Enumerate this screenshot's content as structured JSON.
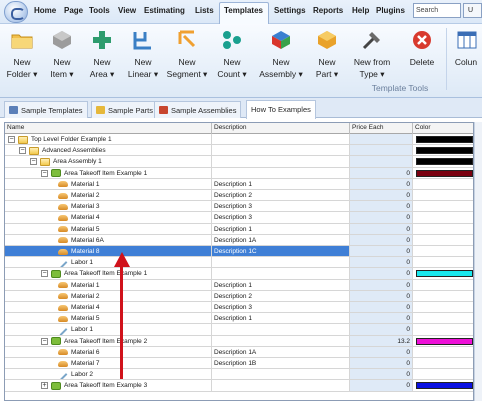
{
  "menu": {
    "items": [
      "Home",
      "Page",
      "Tools",
      "View",
      "Estimating",
      "Lists",
      "Templates",
      "Settings",
      "Reports",
      "Help",
      "Plugins"
    ],
    "active": "Templates",
    "search_placeholder": "Search",
    "user_label": "U"
  },
  "ribbon": {
    "buttons": [
      {
        "line1": "New",
        "line2": "Folder ▾",
        "icon": "folder-icon"
      },
      {
        "line1": "New",
        "line2": "Item ▾",
        "icon": "item-icon"
      },
      {
        "line1": "New",
        "line2": "Area ▾",
        "icon": "area-icon"
      },
      {
        "line1": "New",
        "line2": "Linear ▾",
        "icon": "linear-icon"
      },
      {
        "line1": "New",
        "line2": "Segment ▾",
        "icon": "segment-icon"
      },
      {
        "line1": "New",
        "line2": "Count ▾",
        "icon": "count-icon"
      },
      {
        "line1": "New",
        "line2": "Assembly ▾",
        "icon": "assembly-icon"
      },
      {
        "line1": "New",
        "line2": "Part ▾",
        "icon": "part-icon"
      },
      {
        "line1": "New from",
        "line2": "Type ▾",
        "icon": "hammer-icon"
      },
      {
        "line1": "Delete",
        "line2": "",
        "icon": "delete-icon"
      },
      {
        "line1": "Colun",
        "line2": "",
        "icon": "columns-icon"
      }
    ],
    "group_label": "Template Tools"
  },
  "tabs": [
    {
      "label": "Sample Templates",
      "icon_color": "#5b7fb8"
    },
    {
      "label": "Sample Parts",
      "icon_color": "#e6b83b"
    },
    {
      "label": "Sample Assemblies",
      "icon_color": "#c8462f"
    },
    {
      "label": "How To Examples",
      "icon_color": ""
    }
  ],
  "grid": {
    "headers": {
      "name": "Name",
      "description": "Description",
      "price": "Price Each",
      "color": "Color"
    },
    "rows": [
      {
        "level": 0,
        "type": "folder",
        "expander": "−",
        "name": "Top Level Folder Example 1",
        "desc": "",
        "price": "",
        "color": "#000000"
      },
      {
        "level": 1,
        "type": "folder",
        "expander": "−",
        "name": "Advanced Assemblies",
        "desc": "",
        "price": "",
        "color": "#000000"
      },
      {
        "level": 2,
        "type": "folder",
        "expander": "−",
        "name": "Area Assembly 1",
        "desc": "",
        "price": "",
        "color": "#000000"
      },
      {
        "level": 3,
        "type": "takeoff",
        "expander": "−",
        "name": "Area Takeoff Item Example 1",
        "desc": "",
        "price": "0",
        "color": "#7a0010"
      },
      {
        "level": 4,
        "type": "material",
        "expander": "",
        "name": "Material 1",
        "desc": "Description 1",
        "price": "0",
        "color": ""
      },
      {
        "level": 4,
        "type": "material",
        "expander": "",
        "name": "Material 2",
        "desc": "Description 2",
        "price": "0",
        "color": ""
      },
      {
        "level": 4,
        "type": "material",
        "expander": "",
        "name": "Material 3",
        "desc": "Description 3",
        "price": "0",
        "color": ""
      },
      {
        "level": 4,
        "type": "material",
        "expander": "",
        "name": "Material 4",
        "desc": "Description 3",
        "price": "0",
        "color": ""
      },
      {
        "level": 4,
        "type": "material",
        "expander": "",
        "name": "Material 5",
        "desc": "Description 1",
        "price": "0",
        "color": ""
      },
      {
        "level": 4,
        "type": "material",
        "expander": "",
        "name": "Material 6A",
        "desc": "Description 1A",
        "price": "0",
        "color": ""
      },
      {
        "level": 4,
        "type": "material",
        "expander": "",
        "name": "Material 8",
        "desc": "Description 1C",
        "price": "0",
        "color": "",
        "selected": true
      },
      {
        "level": 4,
        "type": "labor",
        "expander": "",
        "name": "Labor 1",
        "desc": "",
        "price": "0",
        "color": ""
      },
      {
        "level": 3,
        "type": "takeoff",
        "expander": "−",
        "name": "Area Takeoff Item Example 1",
        "desc": "",
        "price": "0",
        "color": "#18e8ee"
      },
      {
        "level": 4,
        "type": "material",
        "expander": "",
        "name": "Material 1",
        "desc": "Description 1",
        "price": "0",
        "color": ""
      },
      {
        "level": 4,
        "type": "material",
        "expander": "",
        "name": "Material 2",
        "desc": "Description 2",
        "price": "0",
        "color": ""
      },
      {
        "level": 4,
        "type": "material",
        "expander": "",
        "name": "Material 4",
        "desc": "Description 3",
        "price": "0",
        "color": ""
      },
      {
        "level": 4,
        "type": "material",
        "expander": "",
        "name": "Material 5",
        "desc": "Description 1",
        "price": "0",
        "color": ""
      },
      {
        "level": 4,
        "type": "labor",
        "expander": "",
        "name": "Labor 1",
        "desc": "",
        "price": "0",
        "color": ""
      },
      {
        "level": 3,
        "type": "takeoff",
        "expander": "−",
        "name": "Area Takeoff Item Example 2",
        "desc": "",
        "price": "13.2",
        "color": "#ee10d8"
      },
      {
        "level": 4,
        "type": "material",
        "expander": "",
        "name": "Material 6",
        "desc": "Description 1A",
        "price": "0",
        "color": ""
      },
      {
        "level": 4,
        "type": "material",
        "expander": "",
        "name": "Material 7",
        "desc": "Description 1B",
        "price": "0",
        "color": ""
      },
      {
        "level": 4,
        "type": "labor",
        "expander": "",
        "name": "Labor 2",
        "desc": "",
        "price": "0",
        "color": ""
      },
      {
        "level": 3,
        "type": "takeoff",
        "expander": "+",
        "name": "Area Takeoff Item Example 3",
        "desc": "",
        "price": "0",
        "color": "#0a10e0"
      }
    ]
  },
  "colors": {
    "ribbon_bg": "#dde9f6",
    "selection": "#3f7fd6",
    "annotation_arrow": "#d0121b"
  }
}
